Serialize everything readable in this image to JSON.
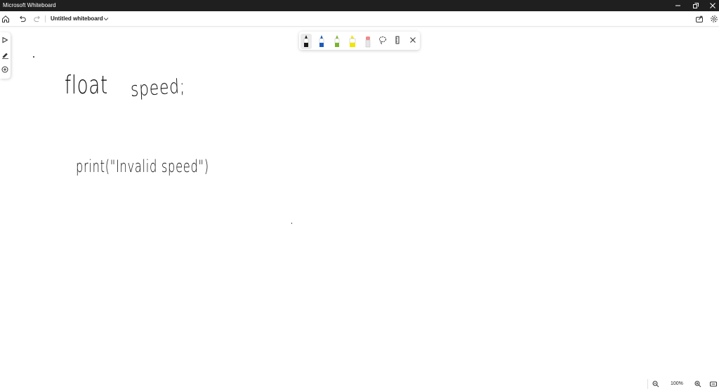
{
  "window": {
    "title": "Microsoft Whiteboard"
  },
  "appbar": {
    "board_title": "Untitled whiteboard"
  },
  "canvas": {
    "lines": [
      "float",
      "speed;",
      "print(\"Invalid speed\")"
    ]
  },
  "ink_toolbar": {
    "pens": [
      {
        "icon": "pen-black-icon",
        "color": "#1a1a1a",
        "selected": true
      },
      {
        "icon": "pen-blue-icon",
        "color": "#1e5bbd",
        "selected": false
      },
      {
        "icon": "pen-green-icon",
        "color": "#7ab52a",
        "selected": false
      },
      {
        "icon": "highlighter-yellow-icon",
        "color": "#f2e600",
        "selected": false
      },
      {
        "icon": "eraser-icon",
        "color": "#f08a8a",
        "selected": false
      }
    ],
    "tools": [
      "lasso-icon",
      "ruler-icon",
      "close-icon"
    ]
  },
  "left_toolbar": {
    "tools": [
      "select-icon",
      "ink-icon",
      "add-icon"
    ]
  },
  "zoom": {
    "level": "100%"
  },
  "theme": {
    "titlebar_bg": "#1f1f1f",
    "canvas_bg": "#ffffff",
    "ink_color": "#111111"
  }
}
